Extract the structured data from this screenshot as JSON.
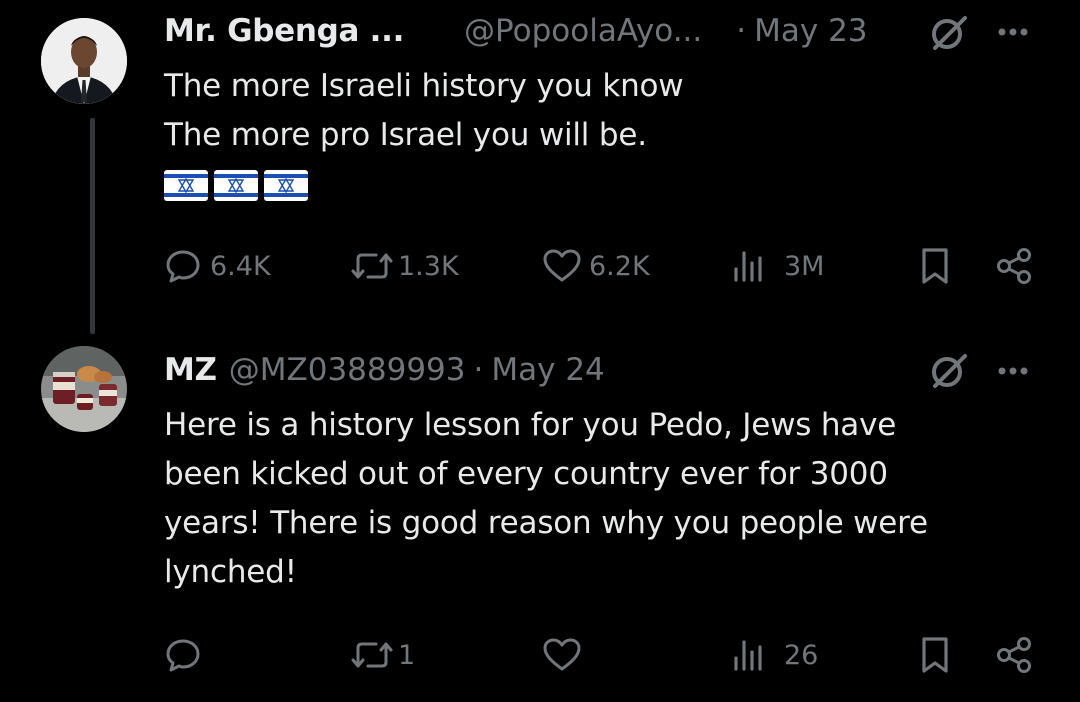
{
  "tweets": [
    {
      "name": "Mr. Gbenga ...",
      "handle": "@PopoolaAyo...",
      "separator": "·",
      "date": "May 23",
      "text_lines": [
        "The more Israeli history you know",
        "The more pro Israel you will be."
      ],
      "flags": [
        "israel-flag",
        "israel-flag",
        "israel-flag"
      ],
      "stats": {
        "replies": "6.4K",
        "reposts": "1.3K",
        "likes": "6.2K",
        "views": "3M"
      }
    },
    {
      "name": "MZ",
      "handle": "@MZ03889993",
      "separator": "·",
      "date": "May 24",
      "text_lines": [
        "Here is a history lesson for you Pedo, Jews have",
        "been kicked out of every country ever for 3000",
        "years! There is good reason why you people were",
        "lynched!"
      ],
      "stats": {
        "replies": "",
        "reposts": "1",
        "likes": "",
        "views": "26"
      }
    }
  ],
  "icons": {
    "reply": "speech-bubble-icon",
    "repost": "repost-arrows-icon",
    "like": "heart-icon",
    "views": "bar-chart-icon",
    "bookmark": "bookmark-icon",
    "share": "share-nodes-icon",
    "grok": "grok-slash-icon",
    "more": "ellipsis-icon"
  },
  "colors": {
    "background": "#000000",
    "primary_text": "#e7e9ea",
    "secondary_text": "#71767b",
    "thread_line": "#333639",
    "flag_blue": "#1b4fb3"
  }
}
